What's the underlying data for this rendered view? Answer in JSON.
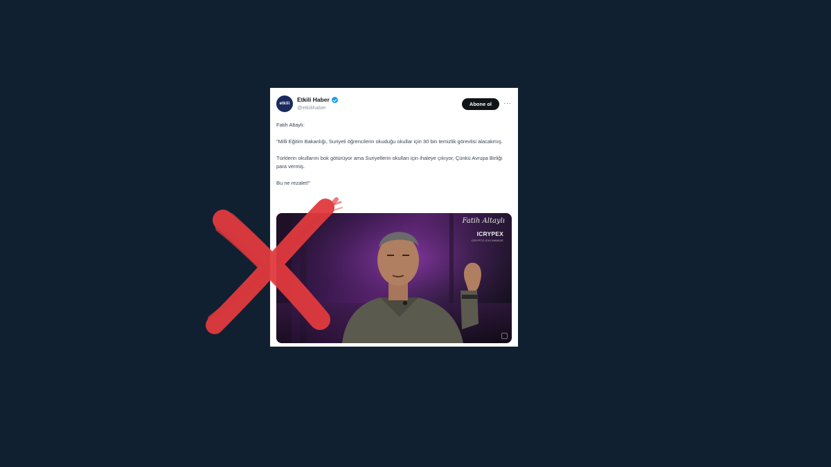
{
  "tweet": {
    "avatar_logo": "etkili",
    "display_name": "Etkili Haber",
    "handle": "@etkilihaber",
    "subscribe_label": "Abone ol",
    "more_icon": "more-horizontal-icon",
    "verified_icon": "verified-badge-icon",
    "paragraphs": [
      "Fatih Altaylı:",
      "\"Milli Eğitim Bakanlığı, Suriyeli öğrencilerin okuduğu okullar için 30 bin temizlik görevlisi alacakmış.",
      "Türklerin okullarını bok götürüyor ama Suriyellerin okulları için ihaleye çıkıyor, Çünkü Avrupa Birliği para vermiş.",
      "Bu ne rezalet!\""
    ]
  },
  "media": {
    "signature": "Fatih Altaylı",
    "brand": "ICRYPEX",
    "brand_sub": "CRYPTO EXCHANGE"
  },
  "overlay": {
    "icon": "red-x-mark-icon",
    "color": "#e03a3e"
  },
  "colors": {
    "background": "#102030",
    "card": "#ffffff",
    "accent_verified": "#1d9bf0"
  }
}
